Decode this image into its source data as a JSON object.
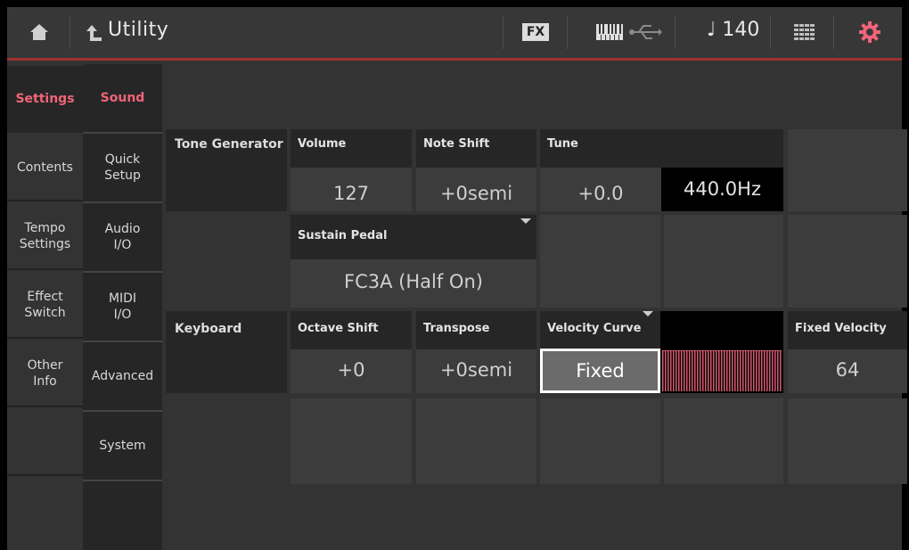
{
  "topbar": {
    "title": "Utility",
    "fx_badge": "FX",
    "tempo": "♩ 140",
    "icons": [
      "home-icon",
      "back-arrow-icon",
      "keyboard-icon",
      "usb-icon",
      "grid-icon",
      "gear-icon"
    ],
    "accent_color": "#f06478"
  },
  "left_tabs": [
    {
      "label": "Settings",
      "active": true
    },
    {
      "label": "Contents"
    },
    {
      "label": "Tempo\nSettings"
    },
    {
      "label": "Effect\nSwitch"
    },
    {
      "label": "Other\nInfo"
    }
  ],
  "sub_tabs": [
    {
      "label": "Sound",
      "active": true
    },
    {
      "label": "Quick\nSetup"
    },
    {
      "label": "Audio\nI/O"
    },
    {
      "label": "MIDI\nI/O"
    },
    {
      "label": "Advanced"
    },
    {
      "label": "System"
    }
  ],
  "sections": {
    "tone_generator": "Tone Generator",
    "keyboard": "Keyboard"
  },
  "params": {
    "volume": {
      "label": "Volume",
      "value": "127"
    },
    "note_shift": {
      "label": "Note Shift",
      "value": "+0semi"
    },
    "tune": {
      "label": "Tune",
      "value": "+0.0",
      "hz": "440.0Hz"
    },
    "sustain_pedal": {
      "label": "Sustain Pedal",
      "value": "FC3A (Half On)"
    },
    "octave_shift": {
      "label": "Octave Shift",
      "value": "+0"
    },
    "transpose": {
      "label": "Transpose",
      "value": "+0semi"
    },
    "velocity_curve": {
      "label": "Velocity Curve",
      "value": "Fixed"
    },
    "fixed_velocity": {
      "label": "Fixed Velocity",
      "value": "64"
    }
  }
}
